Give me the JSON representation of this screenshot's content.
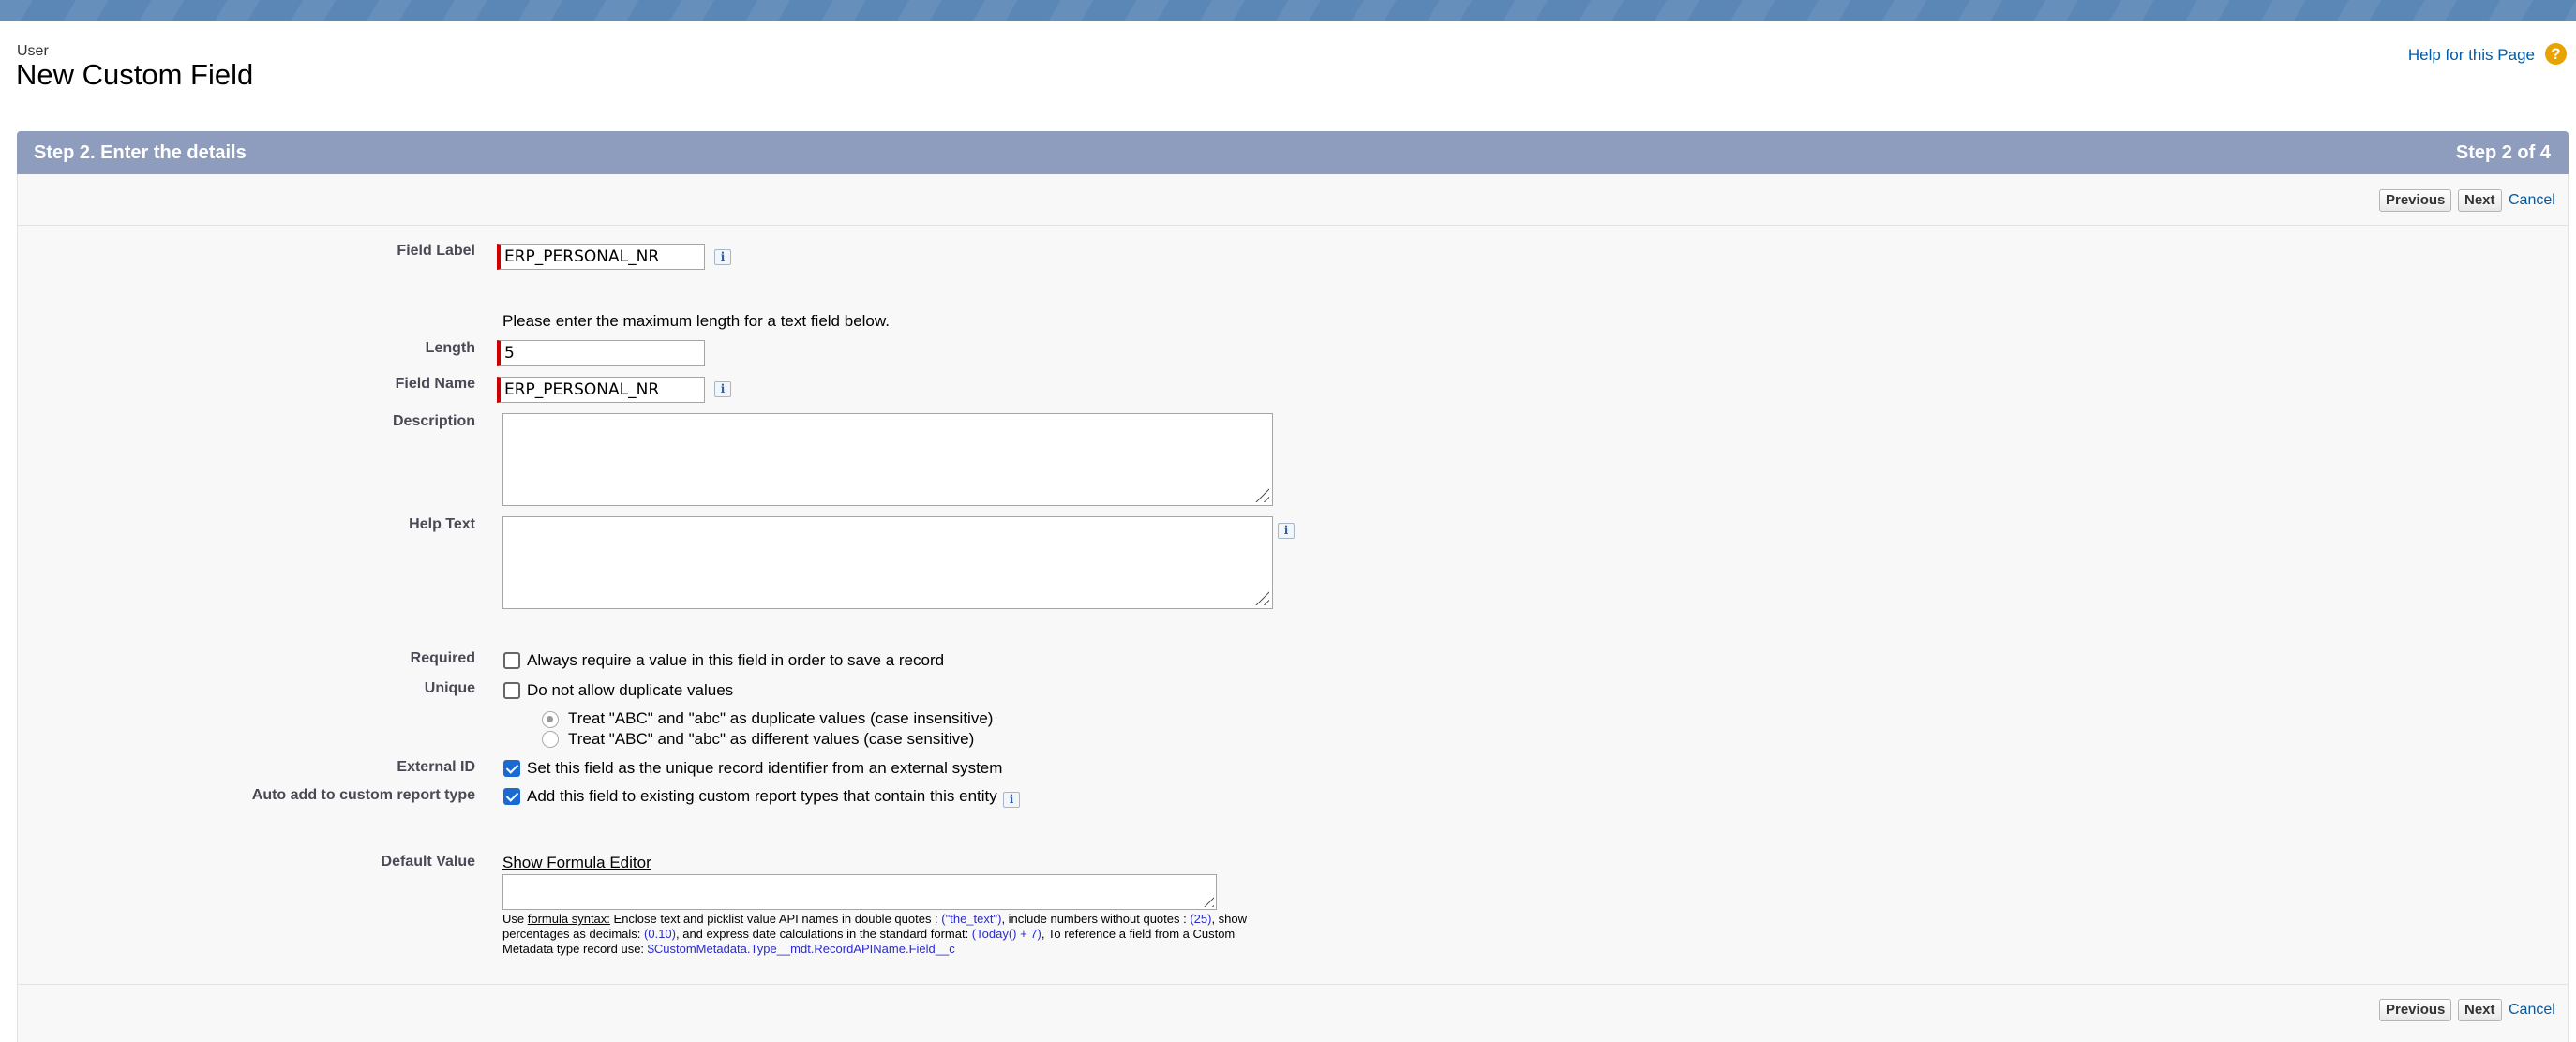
{
  "header": {
    "object_type": "User",
    "title": "New Custom Field",
    "help_link": "Help for this Page",
    "help_icon": "help-question-icon"
  },
  "step": {
    "title": "Step 2. Enter the details",
    "count": "Step 2 of 4"
  },
  "buttons": {
    "previous": "Previous",
    "next": "Next",
    "cancel": "Cancel"
  },
  "form": {
    "field_label": {
      "label": "Field Label",
      "value": "ERP_PERSONAL_NR"
    },
    "length_note": "Please enter the maximum length for a text field below.",
    "length": {
      "label": "Length",
      "value": "5"
    },
    "field_name": {
      "label": "Field Name",
      "value": "ERP_PERSONAL_NR"
    },
    "description": {
      "label": "Description",
      "value": ""
    },
    "help_text": {
      "label": "Help Text",
      "value": ""
    },
    "required": {
      "label": "Required",
      "text": "Always require a value in this field in order to save a record",
      "checked": false
    },
    "unique": {
      "label": "Unique",
      "text": "Do not allow duplicate values",
      "checked": false,
      "option_insensitive": "Treat \"ABC\" and \"abc\" as duplicate values (case insensitive)",
      "option_sensitive": "Treat \"ABC\" and \"abc\" as different values (case sensitive)"
    },
    "external_id": {
      "label": "External ID",
      "text": "Set this field as the unique record identifier from an external system",
      "checked": true
    },
    "auto_add": {
      "label": "Auto add to custom report type",
      "text": "Add this field to existing custom report types that contain this entity",
      "checked": true
    },
    "default_value": {
      "label": "Default Value",
      "formula_link": "Show Formula Editor",
      "value": "",
      "hint": {
        "use": "Use",
        "syntax_link": "formula syntax:",
        "p1": " Enclose text and picklist value API names in double quotes : ",
        "c1": "(\"the_text\")",
        "p2": ", include numbers without quotes : ",
        "c2": "(25)",
        "p3": ", show percentages as decimals: ",
        "c3": "(0.10)",
        "p4": ", and express date calculations in the standard format: ",
        "c4": "(Today() + 7)",
        "p5": ", To reference a field from a Custom Metadata type record use: ",
        "c5": "$CustomMetadata.Type__mdt.RecordAPIName.Field__c"
      }
    }
  },
  "icons": {
    "info": "info-icon",
    "resize": "resize-grip-icon"
  },
  "colors": {
    "header_band": "#8e9dbe",
    "link": "#015ba7",
    "required_marker": "#cc0000",
    "checkbox_checked": "#1a6ad2",
    "help_icon": "#e8a202"
  }
}
